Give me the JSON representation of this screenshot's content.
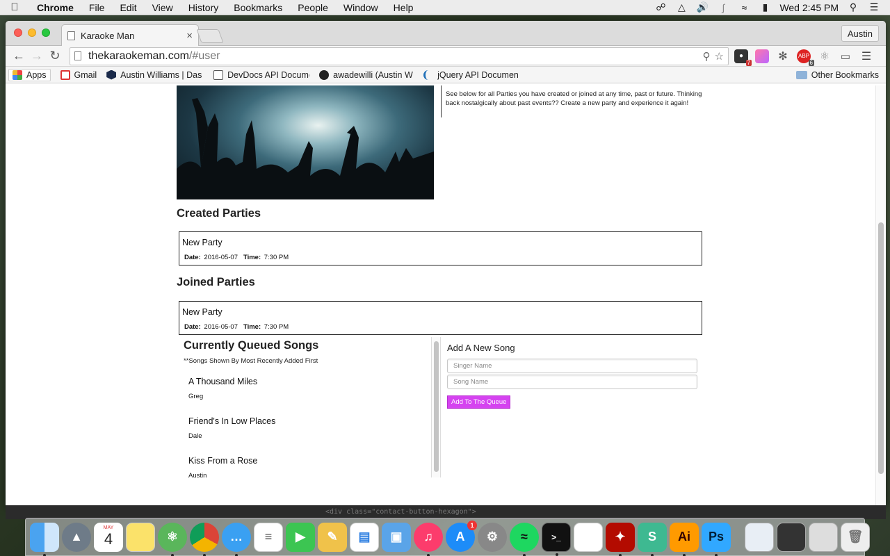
{
  "menubar": {
    "app_name": "Chrome",
    "menus": [
      "File",
      "Edit",
      "View",
      "History",
      "Bookmarks",
      "People",
      "Window",
      "Help"
    ],
    "clock": "Wed 2:45 PM"
  },
  "browser": {
    "tab_title": "Karaoke Man",
    "profile_name": "Austin",
    "url_host": "thekaraokeman.com",
    "url_path": "/#user",
    "extension_badges": {
      "ext1": "7",
      "abp": "6"
    },
    "bookmarks": [
      {
        "label": "Apps",
        "icon": "apps-grid-icon"
      },
      {
        "label": "Gmail",
        "icon": "gmail-icon"
      },
      {
        "label": "Austin Williams | Das",
        "icon": "hexagon-icon"
      },
      {
        "label": "DevDocs API Docume",
        "icon": "devdocs-icon"
      },
      {
        "label": "awadewilli (Austin W",
        "icon": "github-icon"
      },
      {
        "label": "jQuery API Documen",
        "icon": "jquery-icon"
      }
    ],
    "other_bookmarks": "Other Bookmarks"
  },
  "page": {
    "intro_text": "See below for all Parties you have created or joined at any time, past or future. Thinking back nostalgically about past events?? Create a new party and experience it again!",
    "created_heading": "Created Parties",
    "created_party": {
      "name": "New Party",
      "date_label": "Date:",
      "date": "2016-05-07",
      "time_label": "Time:",
      "time": "7:30 PM"
    },
    "joined_heading": "Joined Parties",
    "joined_party": {
      "name": "New Party",
      "date_label": "Date:",
      "date": "2016-05-07",
      "time_label": "Time:",
      "time": "7:30 PM"
    },
    "queue": {
      "title": "Currently Queued Songs",
      "note": "**Songs Shown By Most Recently Added First",
      "songs": [
        {
          "title": "A Thousand Miles",
          "singer": "Greg"
        },
        {
          "title": "Friend's In Low Places",
          "singer": "Dale"
        },
        {
          "title": "Kiss From a Rose",
          "singer": "Austin"
        }
      ]
    },
    "add_song": {
      "title": "Add A New Song",
      "singer_placeholder": "Singer Name",
      "song_placeholder": "Song Name",
      "button_label": "Add To The Queue"
    }
  },
  "editor_snippet": "<div class=\"contact-button-hexagon\">",
  "dock": {
    "calendar_day": "4",
    "calendar_month": "MAY",
    "app_store_badge": "1"
  },
  "colors": {
    "accent_button": "#d543f0"
  }
}
